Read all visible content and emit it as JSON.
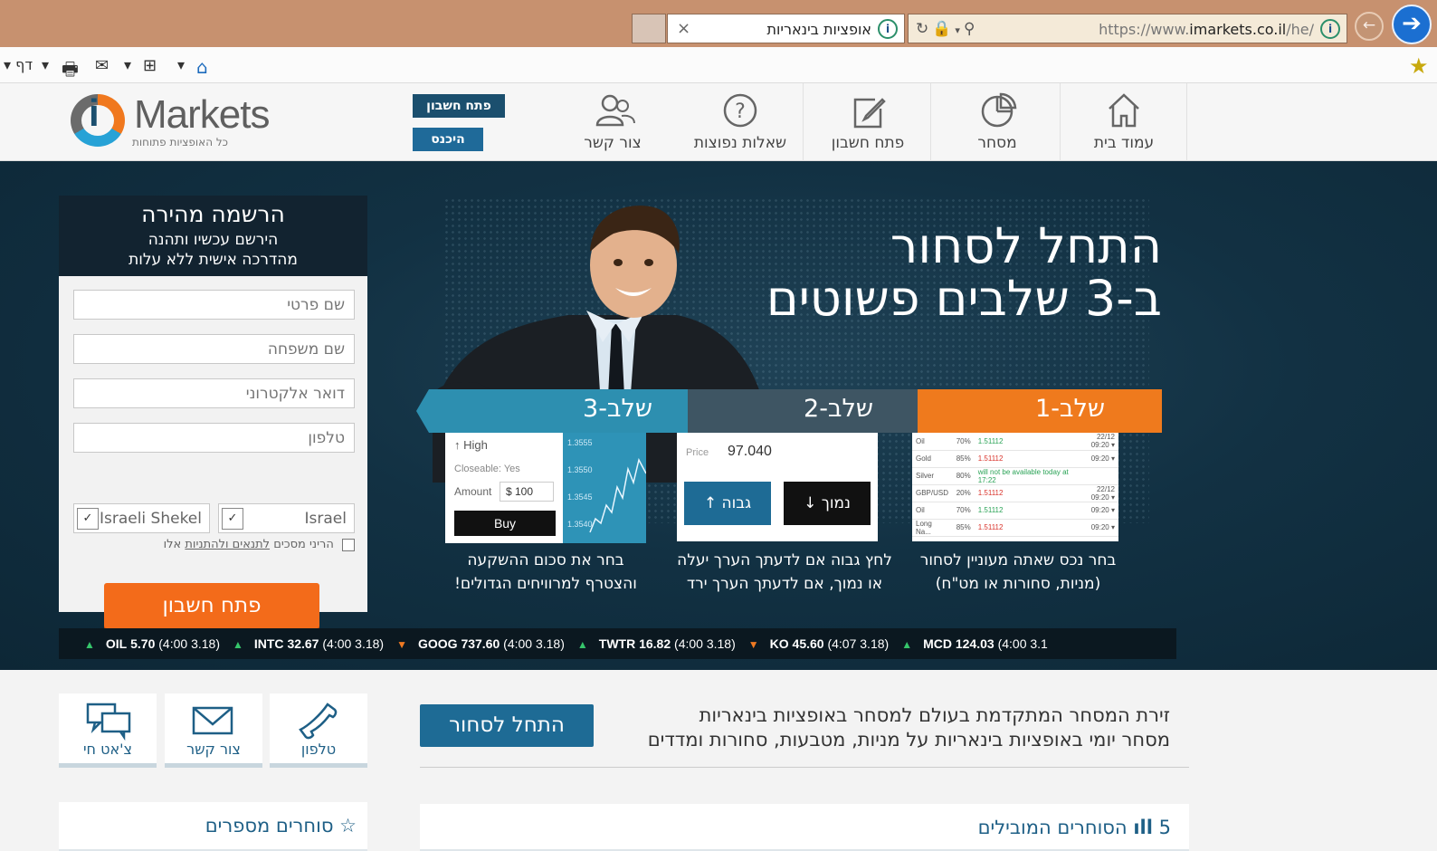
{
  "browser": {
    "url_prefix": "https://www.",
    "url_host": "imarkets.co.il",
    "url_path": "/he/",
    "tab_title": "אופציות בינאריות",
    "tab_close": "×",
    "page_menu": "דף",
    "back_glyph": "➔",
    "fwd_glyph": "←"
  },
  "header": {
    "logo_brand": "Markets",
    "logo_letter": "i",
    "logo_tagline": "כל האופציות פתוחות",
    "nav": [
      {
        "label": "עמוד בית",
        "icon": "home-icon"
      },
      {
        "label": "מסחר",
        "icon": "pie-chart-icon"
      },
      {
        "label": "פתח חשבון",
        "icon": "edit-icon"
      },
      {
        "label": "שאלות נפוצות",
        "icon": "question-icon"
      },
      {
        "label": "צור קשר",
        "icon": "users-icon"
      }
    ],
    "open_account": "פתח חשבון",
    "login": "היכנס"
  },
  "registration": {
    "title": "הרשמה מהירה",
    "subtitle1": "הירשם עכשיו ותהנה",
    "subtitle2": "מהדרכה אישית ללא עלות",
    "first_name_placeholder": "שם פרטי",
    "last_name_placeholder": "שם משפחה",
    "email_placeholder": "דואר אלקטרוני",
    "phone_placeholder": "טלפון",
    "country": "Israel",
    "currency": "Israeli Shekel",
    "terms_prefix": "הריני מסכים",
    "terms_link": "לתנאים ולהתניות",
    "terms_suffix": "אלו",
    "submit": "פתח חשבון"
  },
  "hero": {
    "title_line1": "התחל לסחור",
    "title_line2": "ב-3 שלבים פשוטים",
    "steps": [
      {
        "label": "שלב-1",
        "caption1": "בחר נכס שאתה מעוניין לסחור",
        "caption2": "(מניות, סחורות או מט\"ח)"
      },
      {
        "label": "שלב-2",
        "caption1": "לחץ גבוה אם לדעתך הערך יעלה",
        "caption2": "או נמוך, אם לדעתך הערך ירד"
      },
      {
        "label": "שלב-3",
        "caption1": "בחר את סכום ההשקעה",
        "caption2": "והצטרף למרוויחים הגדולים!"
      }
    ],
    "step1_table": [
      [
        "Oil",
        "70%",
        "1.51112",
        "22/12 09:20 ▾"
      ],
      [
        "Gold",
        "85%",
        "1.51112",
        "09:20 ▾"
      ],
      [
        "Silver",
        "80%",
        "will not be available today at 17:22",
        ""
      ],
      [
        "GBP/USD",
        "20%",
        "1.51112",
        "22/12 09:20 ▾"
      ],
      [
        "Oil",
        "70%",
        "1.51112",
        "09:20 ▾"
      ],
      [
        "Long Na...",
        "85%",
        "1.51112",
        "09:20 ▾"
      ]
    ],
    "step2": {
      "price_label": "Price",
      "price": "97.040",
      "high": "גבוה",
      "low": "נמוך"
    },
    "step3": {
      "high": "High",
      "closeable": "Closeable: Yes",
      "amount_label": "Amount",
      "amount": "$ 100",
      "buy": "Buy",
      "axis": [
        "1.3555",
        "1.3550",
        "1.3545",
        "1.3540"
      ]
    }
  },
  "ticker": [
    {
      "symbol": "OIL",
      "value": "5.70",
      "time": "(4:00 3.18)",
      "dir": "up"
    },
    {
      "symbol": "INTC",
      "value": "32.67",
      "time": "(4:00 3.18)",
      "dir": "up"
    },
    {
      "symbol": "GOOG",
      "value": "737.60",
      "time": "(4:00 3.18)",
      "dir": "down"
    },
    {
      "symbol": "TWTR",
      "value": "16.82",
      "time": "(4:00 3.18)",
      "dir": "up"
    },
    {
      "symbol": "KO",
      "value": "45.60",
      "time": "(4:07 3.18)",
      "dir": "down"
    },
    {
      "symbol": "MCD",
      "value": "124.03",
      "time": "(4:00 3.1",
      "dir": "up"
    }
  ],
  "contact": {
    "phone": "טלפון",
    "email": "צור קשר",
    "chat": "צ'אט חי"
  },
  "cta": {
    "button": "התחל לסחור",
    "line1": "זירת המסחר המתקדמת בעולם למסחר באופציות בינאריות",
    "line2": "מסחר יומי באופציות בינאריות על מניות, מטבעות, סחורות ומדדים"
  },
  "top_traders": {
    "title": "5 הסוחרים המובילים"
  },
  "traders_tell": {
    "title": "סוחרים מספרים"
  },
  "colors": {
    "accent_orange": "#f36b1a",
    "brand_blue": "#1e6b95",
    "hero_bg": "#123143"
  }
}
